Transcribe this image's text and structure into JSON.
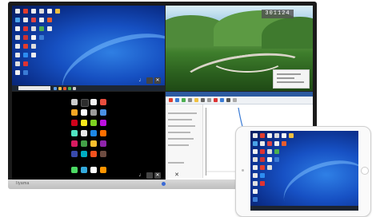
{
  "monitor": {
    "brand_label": "Iiyama",
    "connection_code": "301124"
  },
  "colors": {
    "desktop_blue": "#1650c2",
    "bezel": "#1b1b1b",
    "tablet_body": "#fafafa"
  },
  "icons": {
    "volume": "speaker-icon",
    "grid": "grid-icon",
    "close": "close-icon"
  }
}
